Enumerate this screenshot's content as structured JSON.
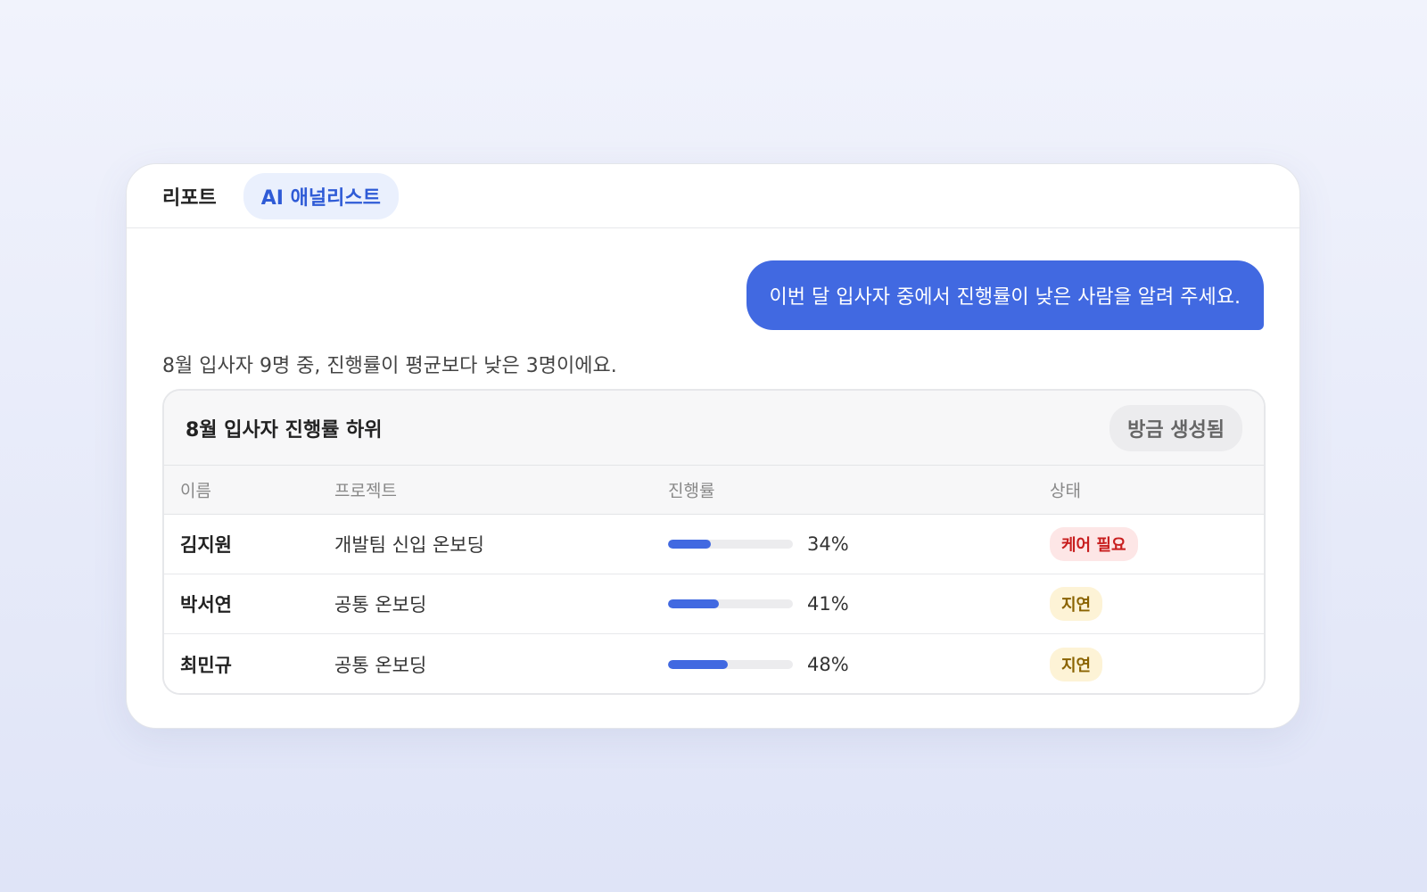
{
  "tabs": [
    {
      "label": "리포트",
      "active": false
    },
    {
      "label": "AI 애널리스트",
      "active": true
    }
  ],
  "chat": {
    "user_message": "이번 달 입사자 중에서 진행률이 낮은 사람을 알려 주세요.",
    "assistant_message": "8월 입사자 9명 중, 진행률이 평균보다 낮은 3명이에요."
  },
  "table": {
    "title": "8월 입사자 진행률 하위",
    "badge": "방금 생성됨",
    "columns": [
      "이름",
      "프로젝트",
      "진행률",
      "상태"
    ],
    "rows": [
      {
        "name": "김지원",
        "project": "개발팀 신입 온보딩",
        "progress": 34,
        "progress_label": "34%",
        "status": "케어 필요",
        "status_tone": "red"
      },
      {
        "name": "박서연",
        "project": "공통 온보딩",
        "progress": 41,
        "progress_label": "41%",
        "status": "지연",
        "status_tone": "yellow"
      },
      {
        "name": "최민규",
        "project": "공통 온보딩",
        "progress": 48,
        "progress_label": "48%",
        "status": "지연",
        "status_tone": "yellow"
      }
    ]
  },
  "colors": {
    "accent": "#4169e1",
    "status_red_bg": "#fde6e6",
    "status_red_text": "#c81e1e",
    "status_yellow_bg": "#fdf3d6",
    "status_yellow_text": "#8a6300"
  }
}
